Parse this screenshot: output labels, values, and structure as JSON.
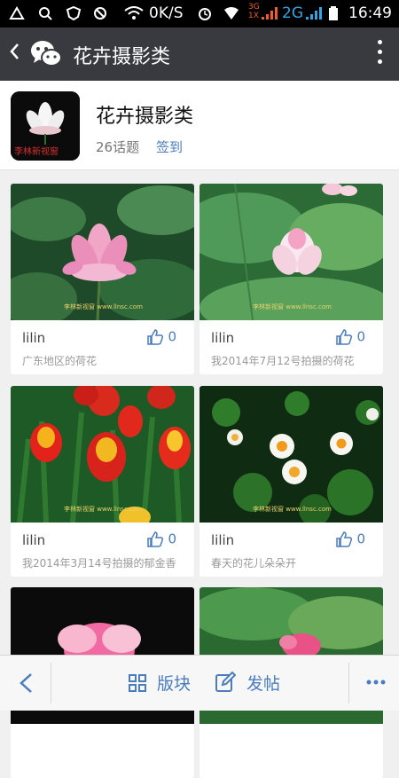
{
  "status_bar": {
    "speed": "0K/S",
    "net_3g": "3G",
    "net_1x": "1X",
    "net_2g": "2G",
    "time": "16:49"
  },
  "title_bar": {
    "back_icon": "chevron-left-icon",
    "app_icon": "wechat-icon",
    "title": "花卉摄影类",
    "menu_icon": "more-vertical-icon"
  },
  "forum": {
    "name": "花卉摄影类",
    "topics": "26话题",
    "checkin": "签到",
    "logo_text": "李林新视窗"
  },
  "posts": [
    {
      "author": "lilin",
      "likes": "0",
      "title": "广东地区的荷花",
      "photo": "pink-lotus",
      "watermark": "李林新视窗 www.llnsc.com"
    },
    {
      "author": "lilin",
      "likes": "0",
      "title": "我2014年7月12号拍摄的荷花",
      "photo": "white-lotus",
      "watermark": "李林新视窗 www.llnsc.com"
    },
    {
      "author": "lilin",
      "likes": "0",
      "title": "我2014年3月14号拍摄的郁金香",
      "photo": "red-tulips",
      "watermark": "李林新视窗 www.llnsc.com"
    },
    {
      "author": "lilin",
      "likes": "0",
      "title": "春天的花儿朵朵开",
      "photo": "daffodils",
      "watermark": "李林新视窗 www.llnsc.com"
    },
    {
      "author": "",
      "likes": "",
      "title": "",
      "photo": "pink-lotus-dark",
      "watermark": ""
    },
    {
      "author": "",
      "likes": "",
      "title": "",
      "photo": "lotus-leaves",
      "watermark": ""
    }
  ],
  "bottom_bar": {
    "back_icon": "chevron-left-icon",
    "sections_label": "版块",
    "sections_icon": "grid-icon",
    "post_label": "发帖",
    "post_icon": "edit-icon",
    "more_icon": "more-horizontal-icon"
  },
  "colors": {
    "titlebar": "#393a3f",
    "accent": "#4a7cc0"
  }
}
